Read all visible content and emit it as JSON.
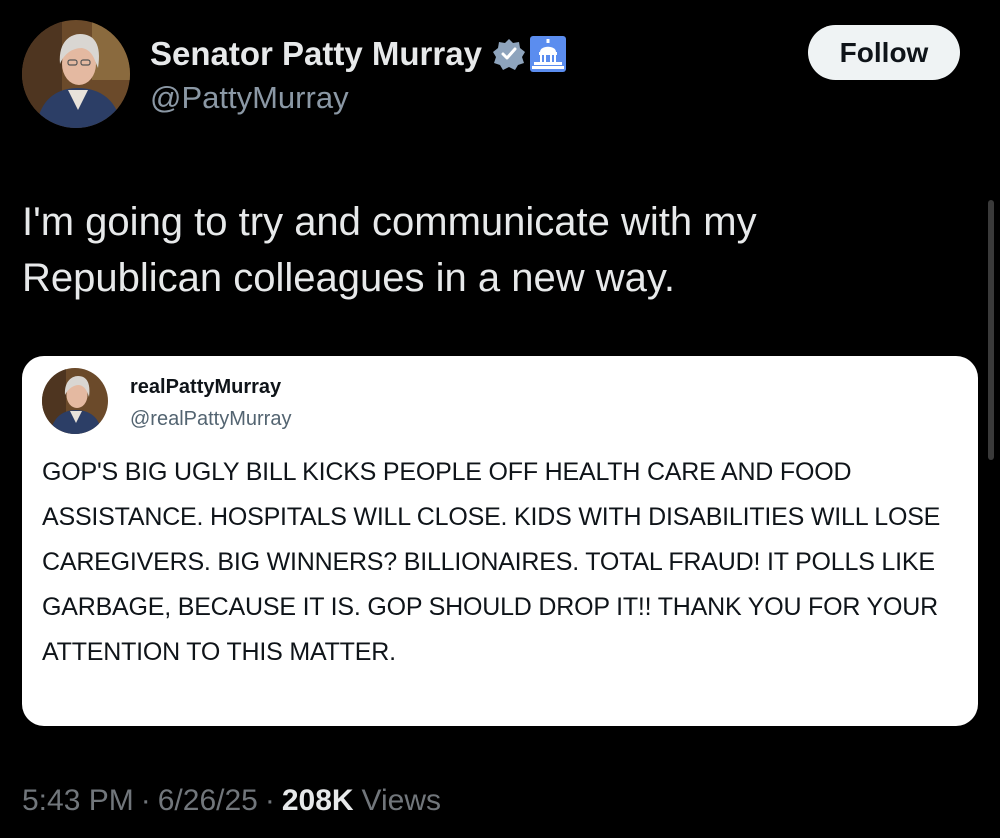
{
  "tweet": {
    "author": {
      "name": "Senator Patty Murray",
      "handle": "@PattyMurray",
      "verified_icon": "verified-badge-icon",
      "affiliation_icon": "capitol-building-icon"
    },
    "follow_label": "Follow",
    "text": "I'm going to try and communicate with my Republican colleagues in a new way.",
    "quote": {
      "name": "realPattyMurray",
      "handle": "@realPattyMurray",
      "text": "GOP'S BIG UGLY BILL KICKS PEOPLE OFF HEALTH CARE AND FOOD ASSISTANCE. HOSPITALS WILL CLOSE. KIDS WITH DISABILITIES WILL LOSE CAREGIVERS. BIG WINNERS? BILLIONAIRES. TOTAL FRAUD! IT POLLS LIKE GARBAGE, BECAUSE IT IS. GOP SHOULD DROP IT!! THANK YOU FOR YOUR ATTENTION TO THIS MATTER."
    },
    "meta": {
      "time": "5:43 PM",
      "separator": "·",
      "date": "6/26/25",
      "views_count": "208K",
      "views_label": "Views"
    }
  },
  "colors": {
    "background": "#000000",
    "primary_text": "#e7e9ea",
    "secondary_text": "#71767b",
    "verified_badge": "#8ea4bd",
    "capitol_badge": "#5b8def",
    "quote_background": "#ffffff",
    "follow_button": "#eff3f4"
  }
}
